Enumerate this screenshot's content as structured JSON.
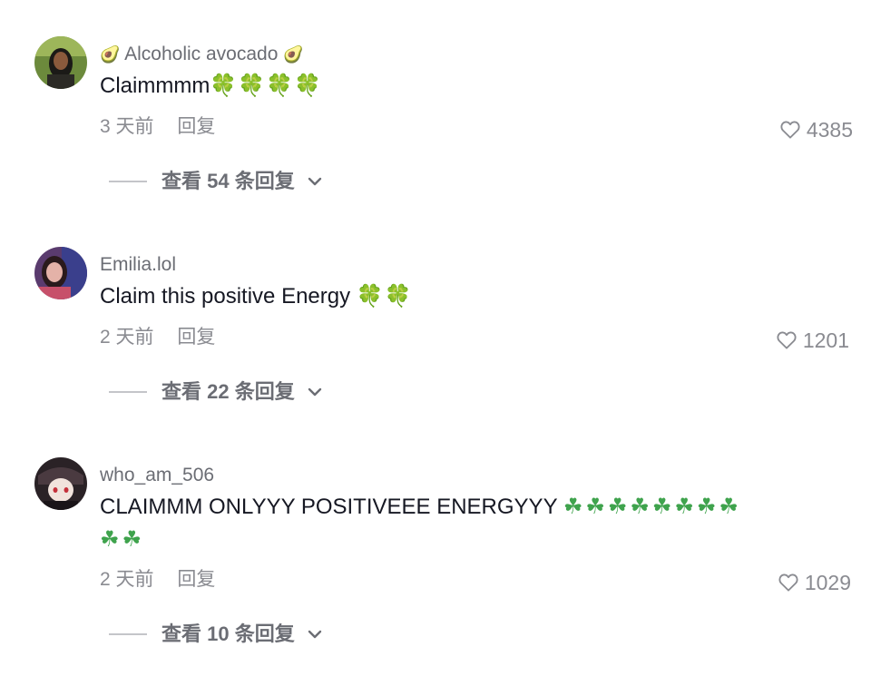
{
  "comments": [
    {
      "username": "Alcoholic avocado",
      "username_prefix_emoji": "🥑",
      "username_suffix_emoji": "🥑",
      "text": "Claimmmm",
      "text_emoji": "🍀🍀🍀🍀",
      "time": "3 天前",
      "reply_label": "回复",
      "likes": "4385",
      "view_replies": "查看 54 条回复"
    },
    {
      "username": "Emilia.lol",
      "text": "Claim this positive Energy ",
      "text_emoji": "🍀🍀",
      "time": "2 天前",
      "reply_label": "回复",
      "likes": "1201",
      "view_replies": "查看 22 条回复"
    },
    {
      "username": "who_am_506",
      "text": "CLAIMMM ONLYYY POSITIVEEE ENERGYYY ",
      "text_emoji": "☘☘☘☘☘☘☘☘☘☘",
      "time": "2 天前",
      "reply_label": "回复",
      "likes": "1029",
      "view_replies": "查看 10 条回复"
    }
  ],
  "icons": {
    "like": "heart-outline-icon",
    "expand": "chevron-down-icon"
  },
  "colors": {
    "clover": "#3fa34d",
    "meta": "#8a8b91",
    "username": "#6b6d74",
    "text": "#161823"
  }
}
